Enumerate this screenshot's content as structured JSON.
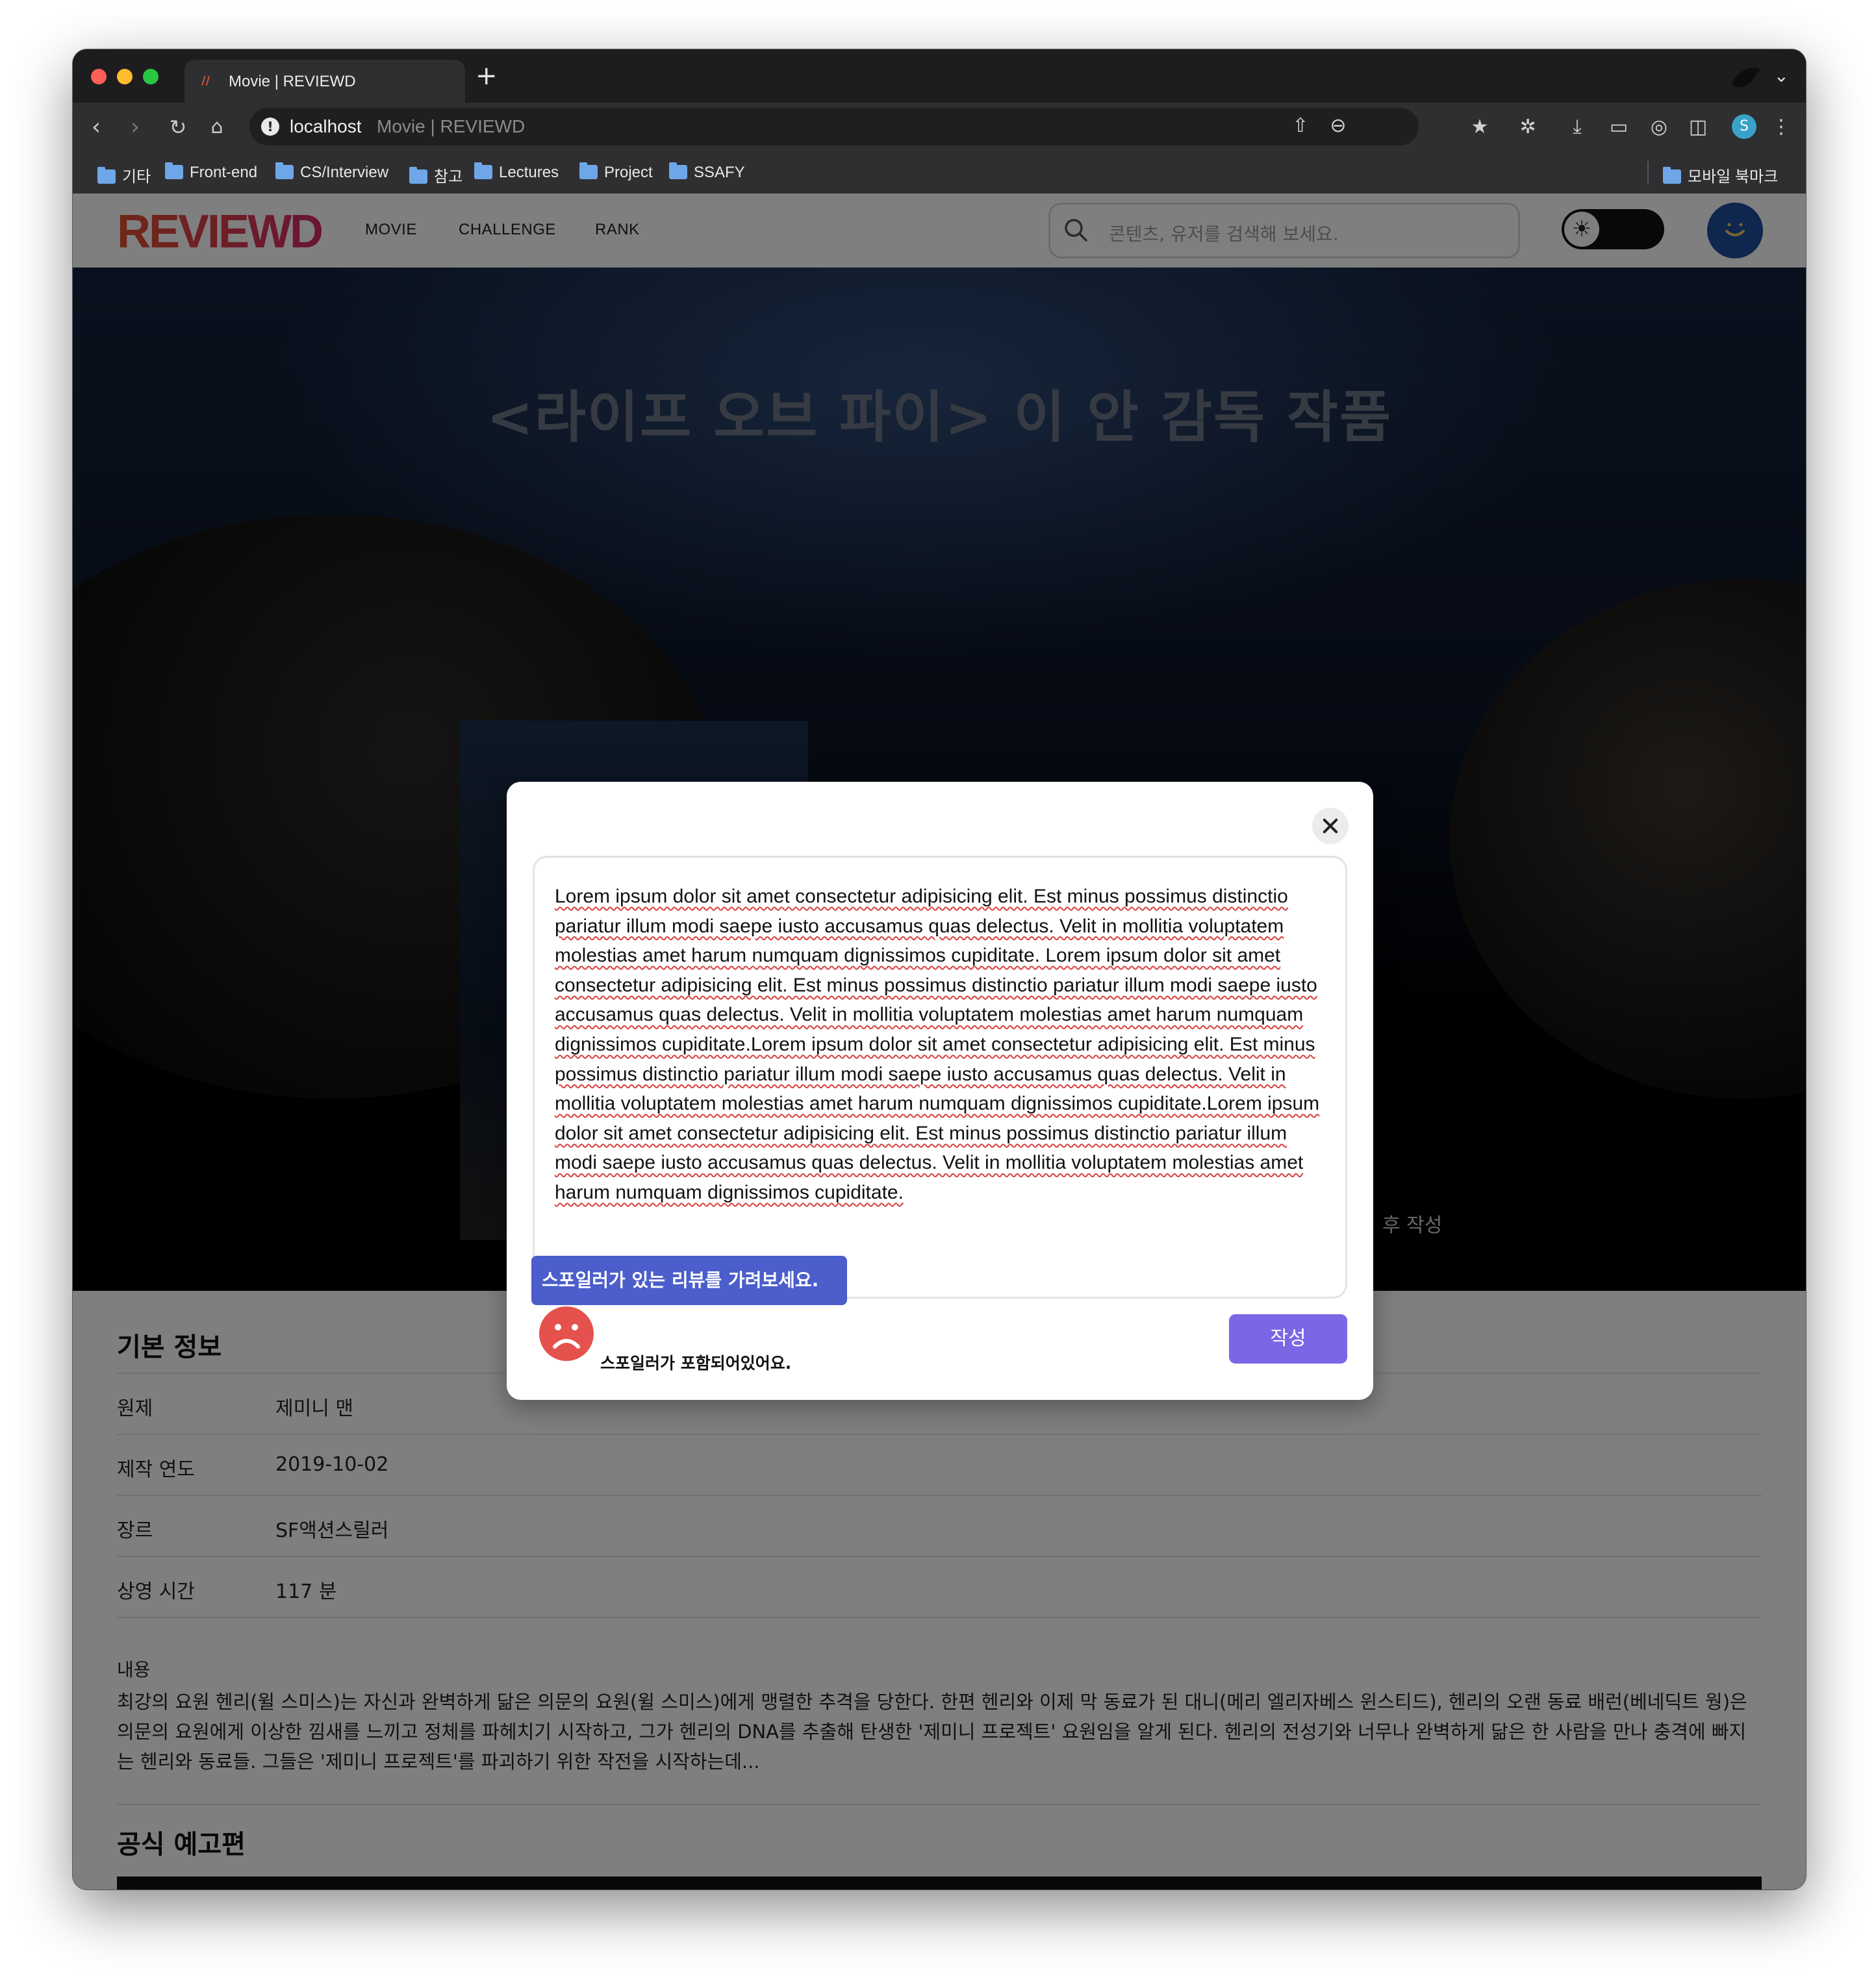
{
  "browser": {
    "tab_title": "Movie | REVIEWD",
    "tab_favicon": "//",
    "new_tab": "+",
    "url_host": "localhost",
    "url_page_title": "Movie | REVIEWD",
    "profile_initial": "S",
    "bookmarks": [
      "기타",
      "Front-end",
      "CS/Interview",
      "참고",
      "Lectures",
      "Project",
      "SSAFY"
    ],
    "mobile_bookmarks": "모바일 북마크",
    "icons": [
      "back-icon",
      "forward-icon",
      "reload-icon",
      "home-icon",
      "info-icon",
      "share-icon",
      "zoom-icon",
      "favorites-icon",
      "extensions-icon",
      "download-icon",
      "cast-icon",
      "screenshot-icon",
      "sidebar-icon",
      "menu-icon"
    ]
  },
  "site": {
    "logo": "REVIEWD",
    "nav": [
      "MOVIE",
      "CHALLENGE",
      "RANK"
    ],
    "search_placeholder": "콘텐츠, 유저를 검색해 보세요.",
    "theme_icon": "sun-icon"
  },
  "hero": {
    "tagline": "<라이프 오브 파이> 이 안 감독 작품",
    "write_label": "후 작성"
  },
  "info": {
    "title": "기본 정보",
    "rows": [
      {
        "label": "원제",
        "value": "제미니 맨"
      },
      {
        "label": "제작 연도",
        "value": "2019-10-02"
      },
      {
        "label": "장르",
        "value": "SF액션스릴러"
      },
      {
        "label": "상영 시간",
        "value": "117 분"
      }
    ],
    "content_label": "내용",
    "content_text": "최강의 요원 헨리(윌 스미스)는 자신과 완벽하게 닮은 의문의 요원(윌 스미스)에게 맹렬한 추격을 당한다. 한편 헨리와 이제 막 동료가 된 대니(메리 엘리자베스 윈스티드), 헨리의 오랜 동료 배런(베네딕트 웡)은 의문의 요원에게 이상한 낌새를 느끼고 정체를 파헤치기 시작하고, 그가 헨리의 DNA를 추출해 탄생한 '제미니 프로젝트' 요원임을 알게 된다. 헨리의 전성기와 너무나 완벽하게 닮은 한 사람을 만나 충격에 빠지는 헨리와 동료들. 그들은 '제미니 프로젝트'를 파괴하기 위한 작전을 시작하는데...",
    "trailer_title": "공식 예고편"
  },
  "modal": {
    "review_text": "Lorem ipsum dolor sit amet consectetur adipisicing elit. Est minus possimus distinctio pariatur illum modi saepe iusto accusamus quas delectus. Velit in mollitia voluptatem molestias amet harum numquam dignissimos cupiditate. Lorem ipsum dolor sit amet consectetur adipisicing elit. Est minus possimus distinctio pariatur illum modi saepe iusto accusamus quas delectus. Velit in mollitia voluptatem molestias amet harum numquam dignissimos cupiditate.Lorem ipsum dolor sit amet consectetur adipisicing elit. Est minus possimus distinctio pariatur illum modi saepe iusto accusamus quas delectus. Velit in mollitia voluptatem molestias amet harum numquam dignissimos cupiditate.Lorem ipsum dolor sit amet consectetur adipisicing elit. Est minus possimus distinctio pariatur illum modi saepe iusto accusamus quas delectus. Velit in mollitia voluptatem molestias amet harum numquam dignissimos cupiditate.",
    "spoiler_tooltip": "스포일러가 있는 리뷰를 가려보세요.",
    "spoiler_label": "스포일러가 포함되어있어요.",
    "submit_label": "작성"
  },
  "colors": {
    "logo_gradient": [
      "#e0502f",
      "#d52a6a"
    ],
    "spoiler_tooltip_bg": "#4b5ecb",
    "submit_button_bg": "#7a67e6",
    "sad_face": "#e5514c",
    "avatar_bg": "#1f4d9c"
  }
}
